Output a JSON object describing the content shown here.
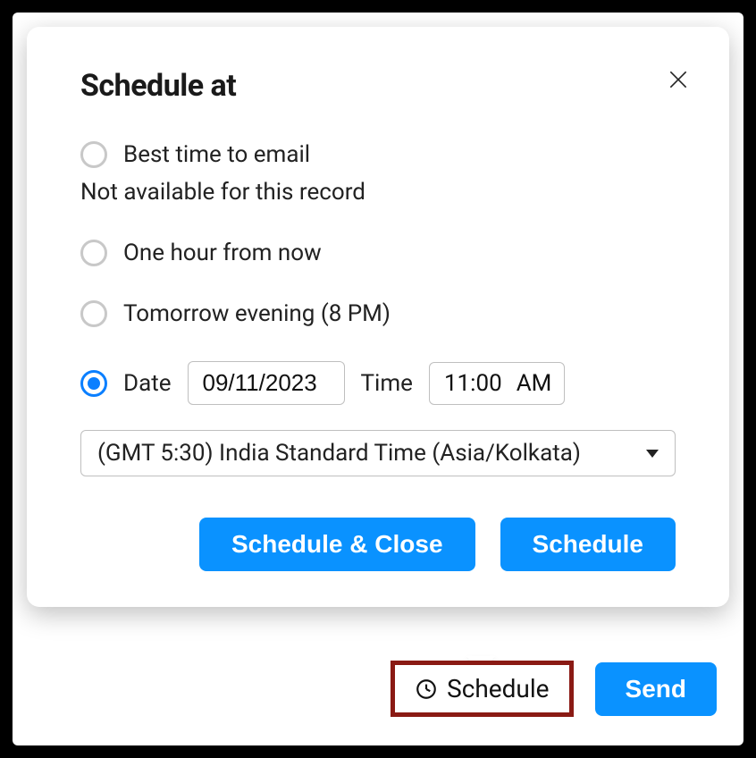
{
  "popup": {
    "title": "Schedule at",
    "options": {
      "best_time": "Best time to email",
      "best_time_note": "Not available for this record",
      "one_hour": "One hour from now",
      "tomorrow": "Tomorrow evening (8 PM)",
      "date_label": "Date",
      "time_label": "Time"
    },
    "date_value": "09/11/2023",
    "time_value": "11:00",
    "time_meridiem": "AM",
    "timezone": "(GMT 5:30) India Standard Time (Asia/Kolkata)",
    "buttons": {
      "schedule_close": "Schedule & Close",
      "schedule": "Schedule"
    }
  },
  "bottom": {
    "schedule": "Schedule",
    "send": "Send"
  }
}
